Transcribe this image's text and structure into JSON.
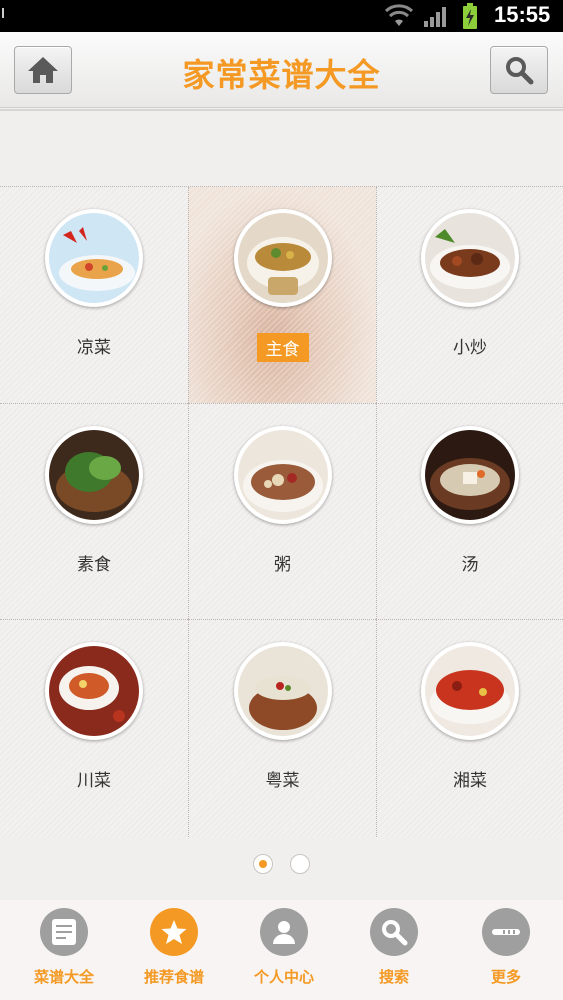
{
  "status_bar": {
    "time": "15:55",
    "icons": [
      "wifi-icon",
      "signal-icon",
      "battery-icon"
    ]
  },
  "header": {
    "title": "家常菜谱大全",
    "left_icon": "home-icon",
    "right_icon": "search-icon"
  },
  "categories": [
    {
      "label": "凉菜",
      "icon": "cold-dish-icon"
    },
    {
      "label": "主食",
      "icon": "staple-food-icon",
      "selected": true
    },
    {
      "label": "小炒",
      "icon": "stir-fry-icon"
    },
    {
      "label": "素食",
      "icon": "vegetarian-icon"
    },
    {
      "label": "粥",
      "icon": "porridge-icon"
    },
    {
      "label": "汤",
      "icon": "soup-icon"
    },
    {
      "label": "川菜",
      "icon": "sichuan-dish-icon"
    },
    {
      "label": "粤菜",
      "icon": "cantonese-dish-icon"
    },
    {
      "label": "湘菜",
      "icon": "hunan-dish-icon"
    }
  ],
  "pagination": {
    "pages": 2,
    "current": 1
  },
  "bottom_nav": [
    {
      "label": "菜谱大全",
      "icon": "menu-list-icon"
    },
    {
      "label": "推荐食谱",
      "icon": "star-icon",
      "active": true
    },
    {
      "label": "个人中心",
      "icon": "user-icon"
    },
    {
      "label": "搜索",
      "icon": "search-icon"
    },
    {
      "label": "更多",
      "icon": "more-icon"
    }
  ],
  "colors": {
    "accent": "#f49a24",
    "nav_inactive": "#9f9f9f"
  }
}
